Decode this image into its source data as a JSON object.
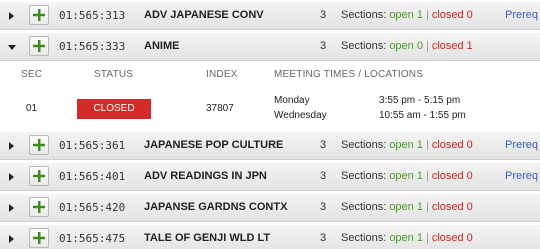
{
  "columns": {
    "sec": "SEC",
    "status": "STATUS",
    "index": "INDEX",
    "meeting": "MEETING TIMES / LOCATIONS"
  },
  "courses": [
    {
      "code": "01:565:313",
      "title": "ADV JAPANESE CONV",
      "units": "3",
      "sections_label": "Sections:",
      "open": "open 1",
      "closed": "closed 0",
      "prereq": "Prereq",
      "expanded": false
    },
    {
      "code": "01:565:333",
      "title": "ANIME",
      "units": "3",
      "sections_label": "Sections:",
      "open": "open 0",
      "closed": "closed 1",
      "prereq": "",
      "expanded": true
    },
    {
      "code": "01:565:361",
      "title": "JAPANESE POP CULTURE",
      "units": "3",
      "sections_label": "Sections:",
      "open": "open 1",
      "closed": "closed 0",
      "prereq": "Prereq",
      "expanded": false
    },
    {
      "code": "01:565:401",
      "title": "ADV READINGS IN JPN",
      "units": "3",
      "sections_label": "Sections:",
      "open": "open 1",
      "closed": "closed 0",
      "prereq": "Prereq",
      "expanded": false
    },
    {
      "code": "01:565:420",
      "title": "JAPANSE GARDNS CONTX",
      "units": "3",
      "sections_label": "Sections:",
      "open": "open 1",
      "closed": "closed 0",
      "prereq": "",
      "expanded": false
    },
    {
      "code": "01:565:475",
      "title": "TALE OF GENJI WLD LT",
      "units": "3",
      "sections_label": "Sections:",
      "open": "open 1",
      "closed": "closed 0",
      "prereq": "",
      "expanded": false
    }
  ],
  "section": {
    "sec": "01",
    "status": "CLOSED",
    "index": "37807",
    "meetings": [
      {
        "day": "Monday",
        "time": "3:55 pm - 5:15 pm"
      },
      {
        "day": "Wednesday",
        "time": "10:55 am - 1:55 pm"
      }
    ]
  },
  "colors": {
    "open": "#4a9a26",
    "closed": "#cc2222",
    "closed_badge": "#d32a2a",
    "prereq_link": "#3a5fbf",
    "plus_icon": "#3f8a1e"
  },
  "icons": {
    "expand": "triangle-right-icon",
    "collapse": "triangle-down-icon",
    "add": "plus-icon"
  }
}
